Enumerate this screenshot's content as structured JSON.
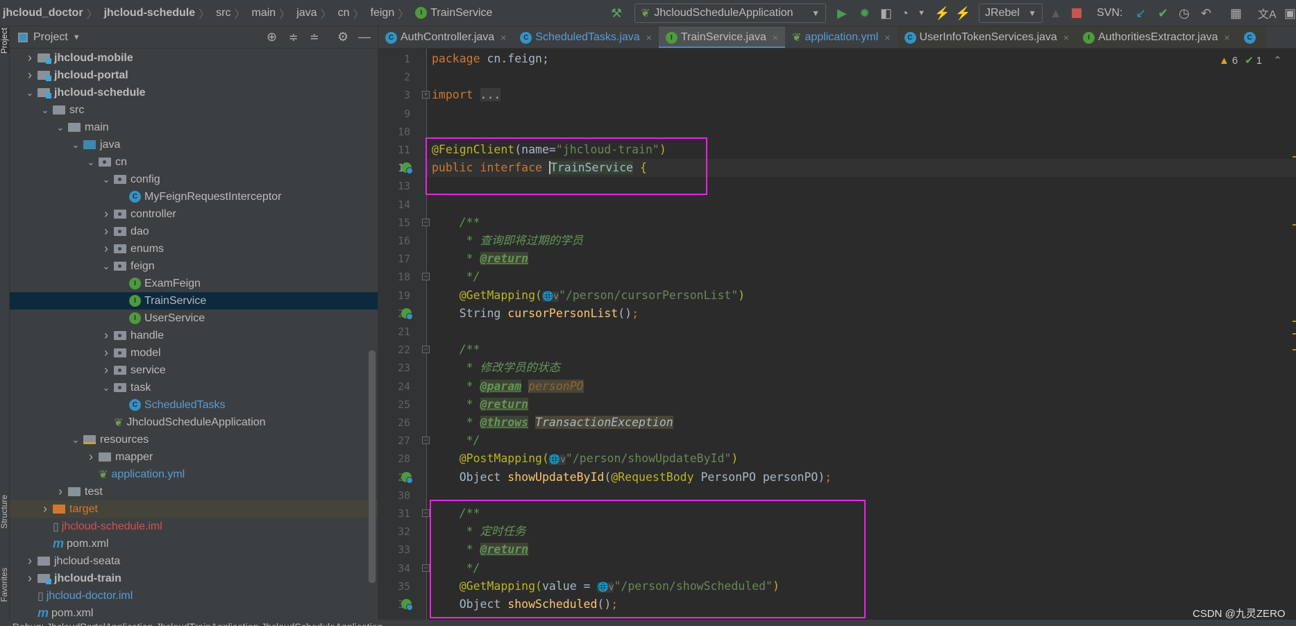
{
  "breadcrumbs": [
    {
      "label": "jhcloud_doctor",
      "bold": true
    },
    {
      "label": "jhcloud-schedule",
      "bold": true
    },
    {
      "label": "src"
    },
    {
      "label": "main"
    },
    {
      "label": "java"
    },
    {
      "label": "cn"
    },
    {
      "label": "feign"
    },
    {
      "label": "TrainService",
      "icon": "I"
    }
  ],
  "toolbar": {
    "run_config": "JhcloudScheduleApplication",
    "jrebel": "JRebel",
    "svn_label": "SVN:",
    "icons": [
      "hammer-icon",
      "run-icon",
      "debug-icon",
      "coverage-icon",
      "profile-icon",
      "jrebel-run-icon",
      "jrebel-debug-icon",
      "stop-icon",
      "svn-update-icon",
      "svn-commit-icon",
      "history-icon",
      "revert-icon",
      "project-structure-icon",
      "translate-icon"
    ]
  },
  "left_strip": {
    "project": "Project",
    "structure": "Structure",
    "favorites": "Favorites"
  },
  "project_panel": {
    "title": "Project"
  },
  "tree": [
    {
      "label": "jhcloud-mobile",
      "d": 1,
      "a": "c",
      "i": "mod",
      "bold": true
    },
    {
      "label": "jhcloud-portal",
      "d": 1,
      "a": "c",
      "i": "mod",
      "bold": true
    },
    {
      "label": "jhcloud-schedule",
      "d": 1,
      "a": "o",
      "i": "mod",
      "bold": true
    },
    {
      "label": "src",
      "d": 2,
      "a": "o",
      "i": "dir"
    },
    {
      "label": "main",
      "d": 3,
      "a": "o",
      "i": "dir"
    },
    {
      "label": "java",
      "d": 4,
      "a": "o",
      "i": "java"
    },
    {
      "label": "cn",
      "d": 5,
      "a": "o",
      "i": "pkg"
    },
    {
      "label": "config",
      "d": 6,
      "a": "o",
      "i": "pkg"
    },
    {
      "label": "MyFeignRequestInterceptor",
      "d": 7,
      "a": "",
      "i": "C"
    },
    {
      "label": "controller",
      "d": 6,
      "a": "c",
      "i": "pkg"
    },
    {
      "label": "dao",
      "d": 6,
      "a": "c",
      "i": "pkg"
    },
    {
      "label": "enums",
      "d": 6,
      "a": "c",
      "i": "pkg"
    },
    {
      "label": "feign",
      "d": 6,
      "a": "o",
      "i": "pkg"
    },
    {
      "label": "ExamFeign",
      "d": 7,
      "a": "",
      "i": "I"
    },
    {
      "label": "TrainService",
      "d": 7,
      "a": "",
      "i": "I",
      "sel": true
    },
    {
      "label": "UserService",
      "d": 7,
      "a": "",
      "i": "I"
    },
    {
      "label": "handle",
      "d": 6,
      "a": "c",
      "i": "pkg"
    },
    {
      "label": "model",
      "d": 6,
      "a": "c",
      "i": "pkg"
    },
    {
      "label": "service",
      "d": 6,
      "a": "c",
      "i": "pkg"
    },
    {
      "label": "task",
      "d": 6,
      "a": "o",
      "i": "pkg"
    },
    {
      "label": "ScheduledTasks",
      "d": 7,
      "a": "",
      "i": "C",
      "color": "#5a9bd5"
    },
    {
      "label": "JhcloudScheduleApplication",
      "d": 6,
      "a": "",
      "i": "spring"
    },
    {
      "label": "resources",
      "d": 4,
      "a": "o",
      "i": "res"
    },
    {
      "label": "mapper",
      "d": 5,
      "a": "c",
      "i": "dir"
    },
    {
      "label": "application.yml",
      "d": 5,
      "a": "",
      "i": "spring",
      "color": "#5a9bd5"
    },
    {
      "label": "test",
      "d": 3,
      "a": "c",
      "i": "dir"
    },
    {
      "label": "target",
      "d": 2,
      "a": "c",
      "i": "target",
      "color": "#d07832",
      "hl": true
    },
    {
      "label": "jhcloud-schedule.iml",
      "d": 2,
      "a": "",
      "i": "iml",
      "color": "#d25252"
    },
    {
      "label": "pom.xml",
      "d": 2,
      "a": "",
      "i": "maven"
    },
    {
      "label": "jhcloud-seata",
      "d": 1,
      "a": "c",
      "i": "dir"
    },
    {
      "label": "jhcloud-train",
      "d": 1,
      "a": "c",
      "i": "mod",
      "bold": true
    },
    {
      "label": "jhcloud-doctor.iml",
      "d": 1,
      "a": "",
      "i": "iml",
      "color": "#5a9bd5"
    },
    {
      "label": "pom.xml",
      "d": 1,
      "a": "",
      "i": "maven"
    }
  ],
  "tabs": [
    {
      "label": "AuthController.java",
      "icon": "C"
    },
    {
      "label": "ScheduledTasks.java",
      "icon": "C",
      "link": true
    },
    {
      "label": "TrainService.java",
      "icon": "I",
      "active": true
    },
    {
      "label": "application.yml",
      "icon": "spring",
      "link": true
    },
    {
      "label": "UserInfoTokenServices.java",
      "icon": "C",
      "locked": true
    },
    {
      "label": "AuthoritiesExtractor.java",
      "icon": "I",
      "locked": true
    },
    {
      "label": "",
      "icon": "C",
      "locked": true
    }
  ],
  "inspections": {
    "warnings": "6",
    "ok": "1"
  },
  "code": [
    {
      "n": "1",
      "t": [
        [
          "kw",
          "package "
        ],
        [
          "pl",
          "cn.feign;"
        ]
      ]
    },
    {
      "n": "2",
      "t": []
    },
    {
      "n": "3",
      "fold": "+",
      "t": [
        [
          "kw",
          "import "
        ],
        [
          "fold2",
          "..."
        ]
      ]
    },
    {
      "n": "9",
      "t": []
    },
    {
      "n": "10",
      "t": []
    },
    {
      "n": "11",
      "t": [
        [
          "an",
          "@FeignClient"
        ],
        [
          "pl",
          "(name="
        ],
        [
          "st",
          "\"jhcloud-train\""
        ],
        [
          "an",
          ")"
        ]
      ]
    },
    {
      "n": "12",
      "cur": true,
      "g": true,
      "t": [
        [
          "kw",
          "public interface "
        ],
        [
          "caret",
          ""
        ],
        [
          "ident",
          "TrainService"
        ],
        [
          "pl",
          " "
        ],
        [
          "an",
          "{"
        ]
      ]
    },
    {
      "n": "13",
      "t": []
    },
    {
      "n": "14",
      "t": []
    },
    {
      "n": "15",
      "fold": "-",
      "t": [
        [
          "cm",
          "    /**"
        ]
      ]
    },
    {
      "n": "16",
      "t": [
        [
          "cm",
          "     * 查询即将过期的学员"
        ]
      ]
    },
    {
      "n": "17",
      "t": [
        [
          "cm",
          "     * "
        ],
        [
          "tag",
          "@return"
        ]
      ]
    },
    {
      "n": "18",
      "fold": "-",
      "t": [
        [
          "cm",
          "     */"
        ]
      ]
    },
    {
      "n": "19",
      "t": [
        [
          "an",
          "    @GetMapping("
        ],
        [
          "glob",
          "🌐v"
        ],
        [
          "st",
          "\"/person/cursorPersonList\""
        ],
        [
          "an",
          ")"
        ]
      ]
    },
    {
      "n": "20",
      "g": true,
      "t": [
        [
          "pl",
          "    String "
        ],
        [
          "fn",
          "cursorPersonList"
        ],
        [
          "pl",
          "()"
        ],
        [
          "kw",
          ";"
        ]
      ]
    },
    {
      "n": "21",
      "t": []
    },
    {
      "n": "22",
      "fold": "-",
      "t": [
        [
          "cm",
          "    /**"
        ]
      ]
    },
    {
      "n": "23",
      "t": [
        [
          "cm",
          "     * 修改学员的状态"
        ]
      ]
    },
    {
      "n": "24",
      "t": [
        [
          "cm",
          "     * "
        ],
        [
          "tag",
          "@param"
        ],
        [
          "cm",
          " "
        ],
        [
          "pv",
          "personPO"
        ]
      ]
    },
    {
      "n": "25",
      "t": [
        [
          "cm",
          "     * "
        ],
        [
          "tag",
          "@return"
        ]
      ]
    },
    {
      "n": "26",
      "t": [
        [
          "cm",
          "     * "
        ],
        [
          "tag",
          "@throws"
        ],
        [
          "cm",
          " "
        ],
        [
          "ex",
          "TransactionException"
        ]
      ]
    },
    {
      "n": "27",
      "fold": "-",
      "t": [
        [
          "cm",
          "     */"
        ]
      ]
    },
    {
      "n": "28",
      "t": [
        [
          "an",
          "    @PostMapping("
        ],
        [
          "glob",
          "🌐v"
        ],
        [
          "st",
          "\"/person/showUpdateById\""
        ],
        [
          "an",
          ")"
        ]
      ]
    },
    {
      "n": "29",
      "g": true,
      "t": [
        [
          "pl",
          "    Object "
        ],
        [
          "fn",
          "showUpdateById"
        ],
        [
          "pl",
          "("
        ],
        [
          "an",
          "@RequestBody "
        ],
        [
          "pl",
          "PersonPO personPO)"
        ],
        [
          "kw",
          ";"
        ]
      ]
    },
    {
      "n": "30",
      "t": []
    },
    {
      "n": "31",
      "fold": "-",
      "t": [
        [
          "cm",
          "    /**"
        ]
      ]
    },
    {
      "n": "32",
      "t": [
        [
          "cm",
          "     * 定时任务"
        ]
      ]
    },
    {
      "n": "33",
      "t": [
        [
          "cm",
          "     * "
        ],
        [
          "tag",
          "@return"
        ]
      ]
    },
    {
      "n": "34",
      "fold": "-",
      "t": [
        [
          "cm",
          "     */"
        ]
      ]
    },
    {
      "n": "35",
      "t": [
        [
          "an",
          "    @GetMapping("
        ],
        [
          "pl",
          "value = "
        ],
        [
          "glob",
          "🌐v"
        ],
        [
          "st",
          "\"/person/showScheduled\""
        ],
        [
          "an",
          ")"
        ]
      ]
    },
    {
      "n": "36",
      "g": true,
      "t": [
        [
          "pl",
          "    Object "
        ],
        [
          "fn",
          "showScheduled"
        ],
        [
          "pl",
          "()"
        ],
        [
          "kw",
          ";"
        ]
      ]
    }
  ],
  "watermark": "CSDN @九灵ZERO",
  "statusbar": "Debug:    JhcloudPortalApplication    JhcloudTrainApplication    JhcloudScheduleApplication",
  "colors": {
    "highlight_box": "#f020e8",
    "selection": "#0d293e",
    "accent": "#4a88c7"
  }
}
